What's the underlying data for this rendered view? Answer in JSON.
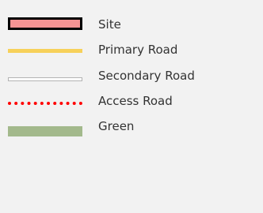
{
  "legend": {
    "items": [
      {
        "label": "Site",
        "swatch": "site-fill-icon",
        "fill": "#f59393",
        "border": "#000000"
      },
      {
        "label": "Primary Road",
        "swatch": "primary-road-line-icon",
        "color": "#f7d15a"
      },
      {
        "label": "Secondary Road",
        "swatch": "secondary-road-line-icon",
        "color": "#ffffff",
        "border": "#b3b3b3"
      },
      {
        "label": "Access Road",
        "swatch": "access-road-dotted-line-icon",
        "color": "#ff0000"
      },
      {
        "label": "Green",
        "swatch": "green-area-fill-icon",
        "color": "#a3b98c"
      }
    ]
  }
}
